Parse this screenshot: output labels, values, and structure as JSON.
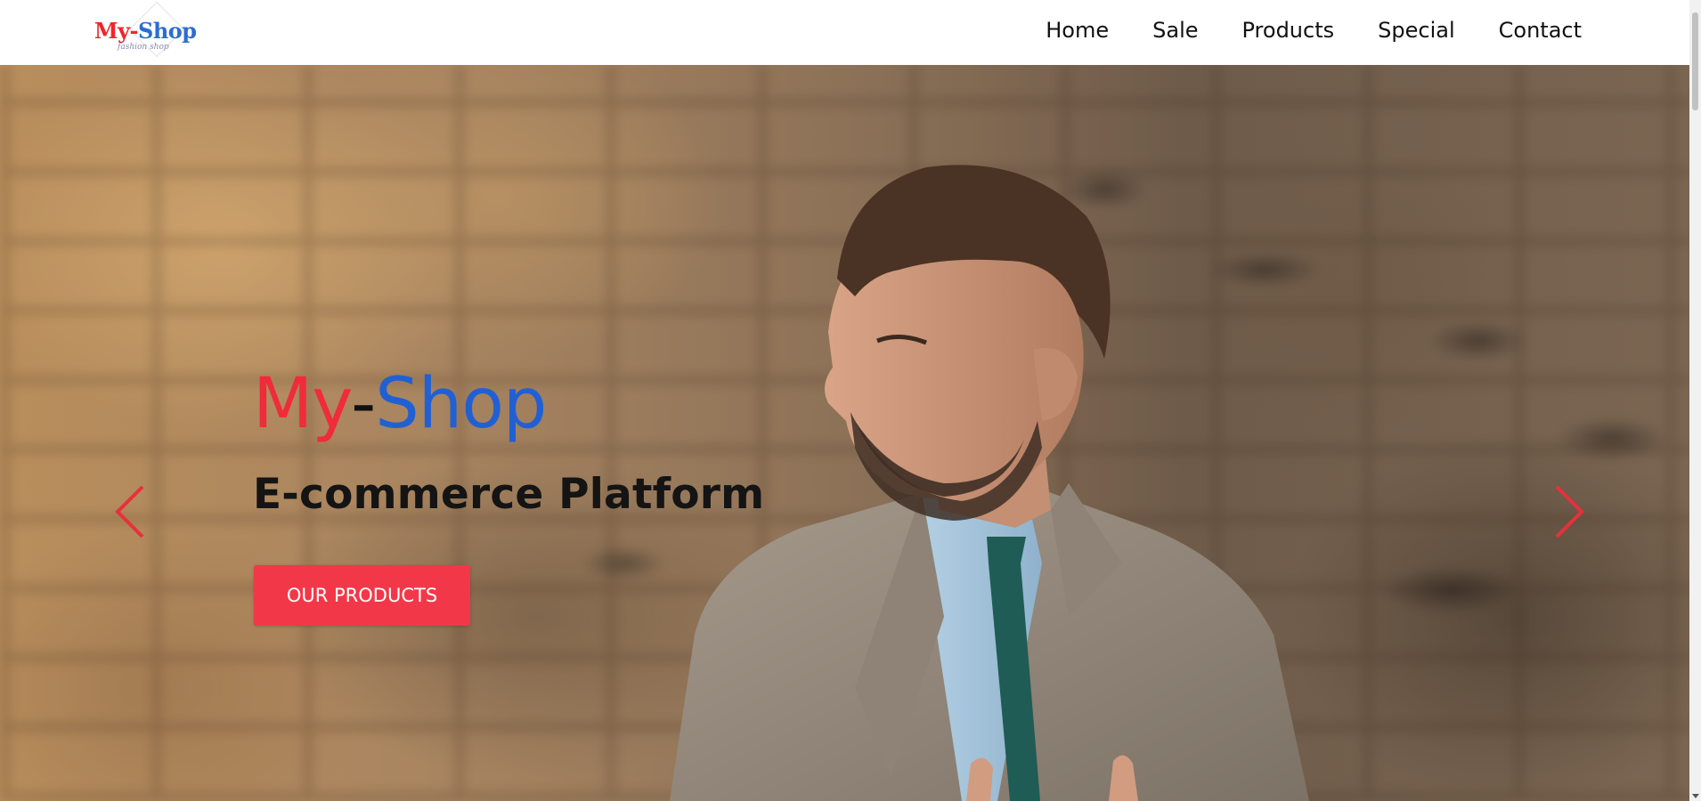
{
  "header": {
    "logo": {
      "part1": "My",
      "dash": "-",
      "part2": "Shop",
      "tagline": "fashion shop"
    },
    "nav": [
      {
        "label": "Home"
      },
      {
        "label": "Sale"
      },
      {
        "label": "Products"
      },
      {
        "label": "Special"
      },
      {
        "label": "Contact"
      }
    ]
  },
  "hero": {
    "title": {
      "part1": "My",
      "dash": "-",
      "part2": "Shop"
    },
    "subtitle": "E-commerce Platform",
    "cta_label": "OUR PRODUCTS",
    "prev_icon": "chevron-left-icon",
    "next_icon": "chevron-right-icon"
  },
  "colors": {
    "brand_red": "#f02b3a",
    "brand_blue": "#2160d3",
    "cta_background": "#f23848",
    "arrow": "#e8303c"
  }
}
